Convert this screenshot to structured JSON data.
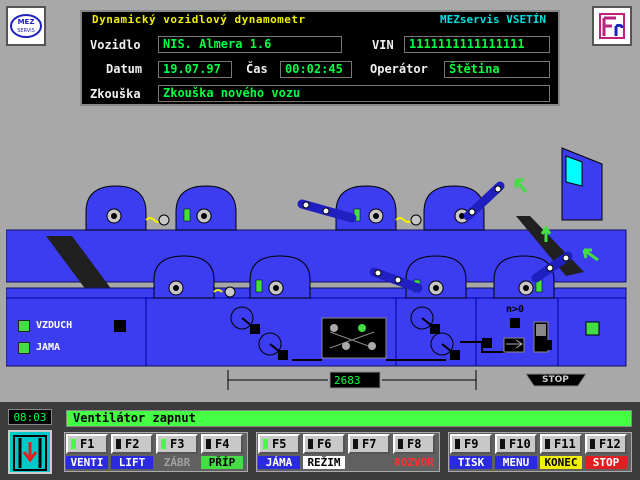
{
  "header": {
    "title": "Dynamický vozidlový dynamometr",
    "company": "MEZservis VSETÍN",
    "left_logo": "MEZservis-logo",
    "right_logo": "Fr-logo"
  },
  "form": {
    "vehicle_label": "Vozidlo",
    "vehicle_value": "NIS. Almera 1.6",
    "vin_label": "VIN",
    "vin_value": "1111111111111111",
    "date_label": "Datum",
    "date_value": "19.07.97",
    "time_label": "Čas",
    "time_value": "00:02:45",
    "operator_label": "Operátor",
    "operator_value": "Štětina",
    "test_label": "Zkouška",
    "test_value": "Zkouška nového vozu"
  },
  "schematic": {
    "vzduch_label": "VZDUCH",
    "jama_label": "JAMA",
    "distance_value": "2683",
    "stop_label": "STOP",
    "n_label": "n>0",
    "colors": {
      "body": "#3c3cf0",
      "dark": "#0000a0",
      "wall": "#a8a8a8",
      "green": "#44dd44"
    }
  },
  "status": {
    "clock": "08:03",
    "message": "Ventilátor zapnut"
  },
  "fkeys": [
    {
      "key": "F1",
      "caption": "VENTI",
      "cap_color": "#ffffff",
      "cap_bg": "#2a2ae0",
      "led": true
    },
    {
      "key": "F2",
      "caption": "LIFT",
      "cap_color": "#ffffff",
      "cap_bg": "#2a2ae0",
      "led": false
    },
    {
      "key": "F3",
      "caption": "ZÁBR",
      "cap_color": "#a0a0a0",
      "cap_bg": "#606060",
      "led": true
    },
    {
      "key": "F4",
      "caption": "PŘÍP",
      "cap_color": "#000000",
      "cap_bg": "#44dd44",
      "led": false
    },
    {
      "key": "F5",
      "caption": "JÁMA",
      "cap_color": "#ffffff",
      "cap_bg": "#2a2ae0",
      "led": true
    },
    {
      "key": "F6",
      "caption": "REŽIM",
      "cap_color": "#000000",
      "cap_bg": "#ffffff",
      "led": false
    },
    {
      "key": "F7",
      "caption": "",
      "cap_color": "#000000",
      "cap_bg": "#606060",
      "led": false
    },
    {
      "key": "F8",
      "caption": "ROZVOR",
      "cap_color": "#ff3030",
      "cap_bg": "#606060",
      "led": false
    },
    {
      "key": "F9",
      "caption": "TISK",
      "cap_color": "#ffffff",
      "cap_bg": "#2a2ae0",
      "led": false
    },
    {
      "key": "F10",
      "caption": "MENU",
      "cap_color": "#ffffff",
      "cap_bg": "#2a2ae0",
      "led": false
    },
    {
      "key": "F11",
      "caption": "KONEC",
      "cap_color": "#000000",
      "cap_bg": "#f0f000",
      "led": false
    },
    {
      "key": "F12",
      "caption": "STOP",
      "cap_color": "#ffffff",
      "cap_bg": "#e02020",
      "led": false
    }
  ]
}
